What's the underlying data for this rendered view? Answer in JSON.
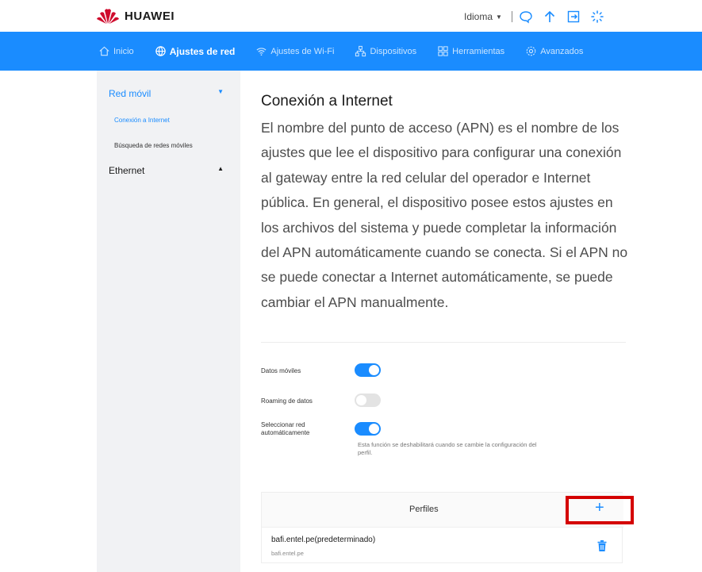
{
  "brand": {
    "name": "HUAWEI",
    "color": "#cf0a2c"
  },
  "header": {
    "language_label": "Idioma",
    "icons": [
      "chat-icon",
      "upload-icon",
      "logout-icon",
      "loading-icon"
    ]
  },
  "nav": {
    "accent": "#1a8cff",
    "items": [
      {
        "label": "Inicio",
        "icon": "home-icon",
        "active": false
      },
      {
        "label": "Ajustes de red",
        "icon": "globe-icon",
        "active": true
      },
      {
        "label": "Ajustes de Wi-Fi",
        "icon": "wifi-icon",
        "active": false
      },
      {
        "label": "Dispositivos",
        "icon": "devices-icon",
        "active": false
      },
      {
        "label": "Herramientas",
        "icon": "tools-icon",
        "active": false
      },
      {
        "label": "Avanzados",
        "icon": "gear-icon",
        "active": false
      }
    ]
  },
  "sidebar": {
    "groups": [
      {
        "label": "Red móvil",
        "expanded": true,
        "items": [
          "Conexión a Internet",
          "Búsqueda de redes móviles"
        ]
      },
      {
        "label": "Ethernet",
        "expanded": false
      }
    ]
  },
  "main": {
    "title": "Conexión a Internet",
    "description": "El nombre del punto de acceso (APN) es el nombre de los ajustes que lee el dispositivo para configurar una conexión al gateway entre la red celular del operador e Internet pública. En general, el dispositivo posee estos ajustes en los archivos del sistema y puede completar la información del APN automáticamente cuando se conecta. Si el APN no se puede conectar a Internet automáticamente, se puede cambiar el APN manualmente.",
    "settings": [
      {
        "label": "Datos móviles",
        "enabled": true
      },
      {
        "label": "Roaming de datos",
        "enabled": false
      },
      {
        "label": "Seleccionar red automáticamente",
        "enabled": true
      }
    ],
    "auto_select_note": "Esta función se deshabilitará cuando se cambie la configuración del perfil.",
    "profiles": {
      "title": "Perfiles",
      "add_label": "+",
      "items": [
        {
          "name": "bafi.entel.pe(predeterminado)",
          "apn": "bafi.entel.pe"
        }
      ]
    }
  },
  "annotation": {
    "highlight_color": "#d40000",
    "target": "add-profile-button"
  }
}
